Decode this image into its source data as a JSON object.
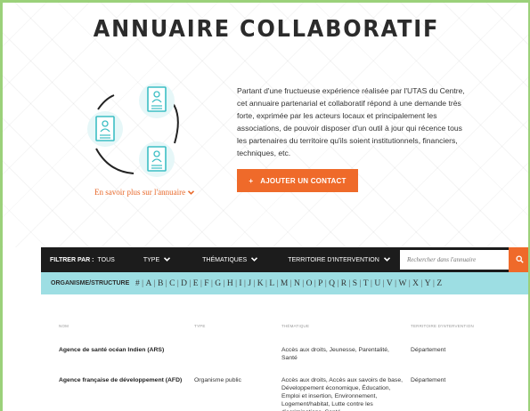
{
  "hero": {
    "title": "ANNUAIRE COLLABORATIF",
    "info_link": "En savoir plus sur l'annuaire",
    "description": "Partant d'une fructueuse expérience réalisée par l'UTAS du Centre, cet annuaire partenarial et collaboratif répond à une demande très forte, exprimée par les acteurs locaux et principalement les associations, de pouvoir disposer d'un outil à jour qui récence tous les partenaires du territoire qu'ils soient institutionnels, financiers, techniques, etc.",
    "add_button": "AJOUTER UN CONTACT",
    "add_button_icon": "+",
    "accent_color": "#ef6a2a",
    "teal_color": "#3cbec4"
  },
  "filter_bar": {
    "label": "FILTRER PAR :",
    "all": "TOUS",
    "type": "TYPE",
    "thematiques": "THÉMATIQUES",
    "territoire": "TERRITOIRE D'INTERVENTION",
    "search_placeholder": "Rechercher dans l'annuaire"
  },
  "alpha_bar": {
    "label": "ORGANISME/STRUCTURE",
    "letters": [
      "#",
      "A",
      "B",
      "C",
      "D",
      "E",
      "F",
      "G",
      "H",
      "I",
      "J",
      "K",
      "L",
      "M",
      "N",
      "O",
      "P",
      "Q",
      "R",
      "S",
      "T",
      "U",
      "V",
      "W",
      "X",
      "Y",
      "Z"
    ]
  },
  "table": {
    "headers": {
      "nom": "NOM",
      "type": "TYPE",
      "thematique": "THÉMATIQUE",
      "territoire": "TERRITOIRE D'INTERVENTION"
    },
    "rows": [
      {
        "nom": "Agence de santé océan Indien (ARS)",
        "type": "",
        "thematique": "Accès aux droits, Jeunesse, Parentalité, Santé",
        "territoire": "Département"
      },
      {
        "nom": "Agence française de développement (AFD)",
        "type": "Organisme public",
        "thematique": "Accès aux droits, Accès aux savoirs de base, Développement économique, Éducation, Emploi et insertion, Environnement, Logement/habitat, Lutte contre les discriminations, Santé",
        "territoire": "Département"
      }
    ]
  }
}
